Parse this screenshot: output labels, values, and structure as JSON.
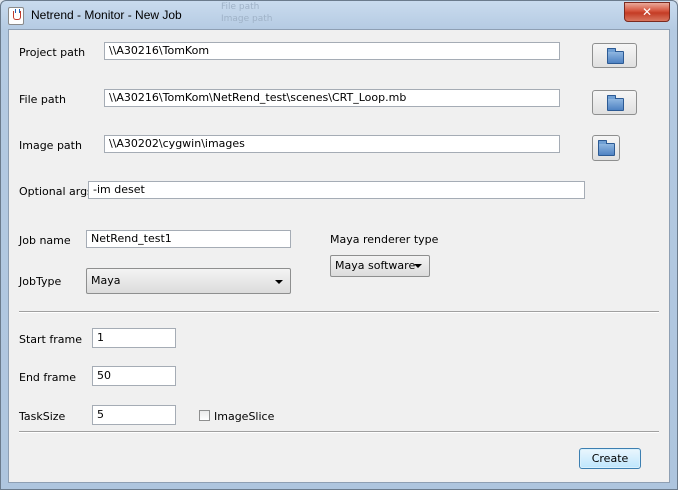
{
  "window": {
    "title": "Netrend - Monitor - New Job",
    "close_label": "✕"
  },
  "background_title_fragments": [
    "File path",
    "Image path"
  ],
  "form": {
    "project_path": {
      "label": "Project path",
      "value": "\\\\A30216\\TomKom"
    },
    "file_path": {
      "label": "File path",
      "value": "\\\\A30216\\TomKom\\NetRend_test\\scenes\\CRT_Loop.mb"
    },
    "image_path": {
      "label": "Image path",
      "value": "\\\\A30202\\cygwin\\images"
    },
    "optional_args": {
      "label": "Optional args",
      "value": "-im deset"
    },
    "job_name": {
      "label": "Job name",
      "value": "NetRend_test1"
    },
    "job_type": {
      "label": "JobType",
      "selected": "Maya"
    },
    "renderer_type": {
      "label": "Maya renderer type",
      "selected": "Maya software"
    },
    "start_frame": {
      "label": "Start frame",
      "value": "1"
    },
    "end_frame": {
      "label": "End frame",
      "value": "50"
    },
    "task_size": {
      "label": "TaskSize",
      "value": "5"
    },
    "image_slice": {
      "label": "ImageSlice",
      "checked": false
    }
  },
  "buttons": {
    "create": "Create"
  },
  "icons": {
    "browse": "folder-icon",
    "close": "close-icon",
    "app": "java-icon"
  },
  "colors": {
    "title_gradient_top": "#c9dbee",
    "close_red": "#c43c25",
    "default_button": "#bee6fd",
    "panel_bg": "#f0f0f0"
  }
}
